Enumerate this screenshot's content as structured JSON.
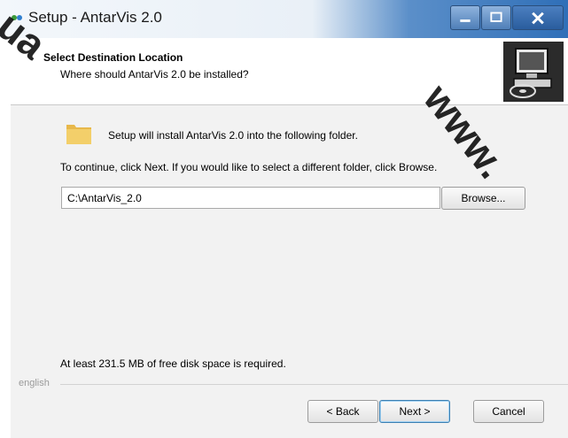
{
  "window": {
    "title": "Setup - AntarVis 2.0",
    "controls": {
      "minimize": "minimize",
      "maximize": "maximize",
      "close": "close"
    }
  },
  "header": {
    "title": "Select Destination Location",
    "subtitle": "Where should AntarVis 2.0 be installed?",
    "image_icon": "computer-disk-icon"
  },
  "body": {
    "folder_icon": "folder-icon",
    "install_text": "Setup will install AntarVis 2.0 into the following folder.",
    "continue_text": "To continue, click Next. If you would like to select a different folder, click Browse.",
    "path_value": "C:\\AntarVis_2.0",
    "browse_label": "Browse...",
    "disk_space_text": "At least 231.5 MB of free disk space is required."
  },
  "footer": {
    "language_label": "english",
    "back_label": "< Back",
    "next_label": "Next >",
    "cancel_label": "Cancel"
  },
  "watermarks": {
    "left": ".ua",
    "right": "www."
  },
  "colors": {
    "titlebar_accent": "#2f6fb8",
    "panel_bg": "#f2f2f2",
    "header_bg": "#ffffff",
    "next_border": "#3c7fb1"
  }
}
